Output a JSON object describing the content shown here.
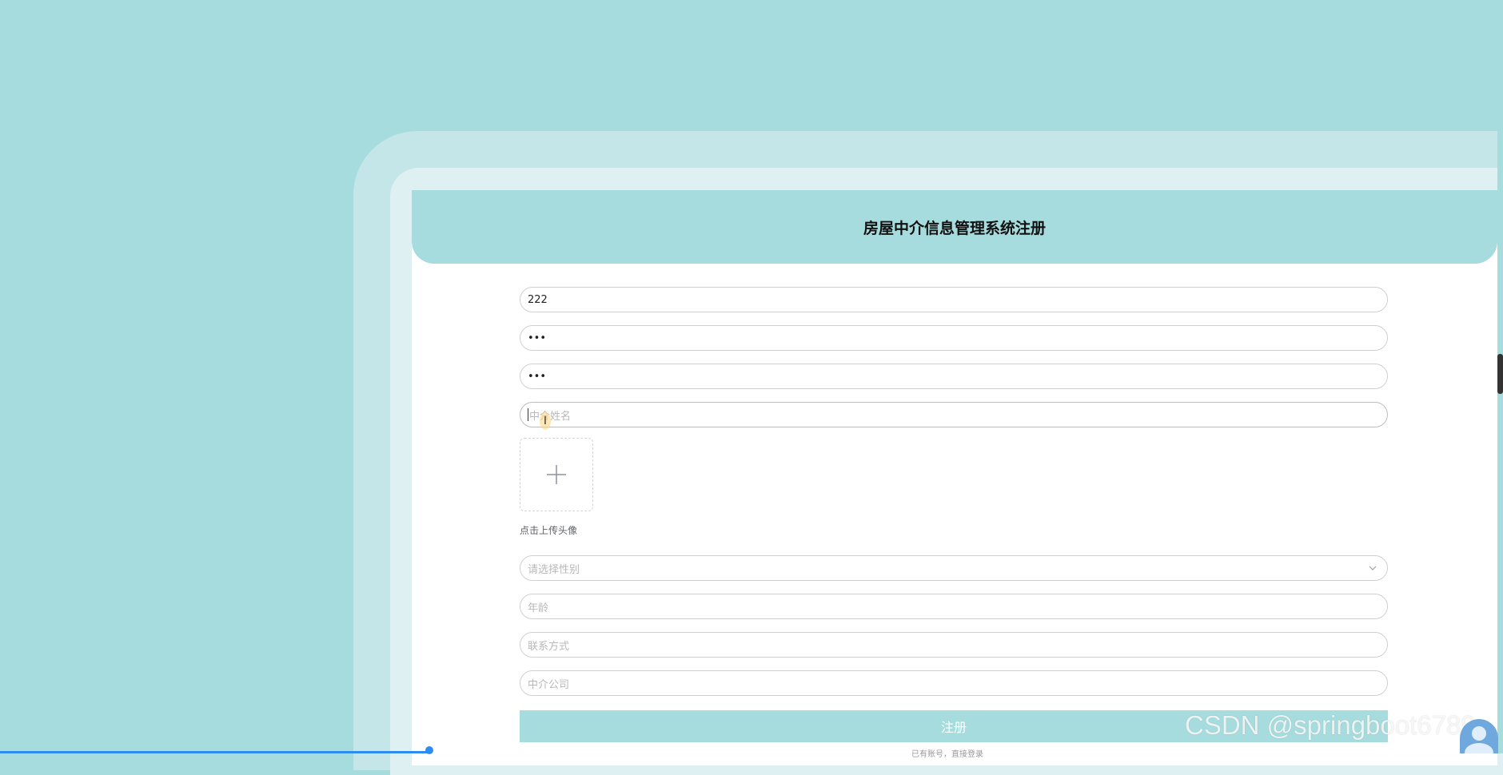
{
  "header": {
    "title": "房屋中介信息管理系统注册"
  },
  "form": {
    "account": {
      "value": "222"
    },
    "password": {
      "value": "•••"
    },
    "confirm_password": {
      "value": "•••"
    },
    "name": {
      "placeholder": "中介姓名"
    },
    "avatar_upload": {
      "label": "点击上传头像"
    },
    "gender": {
      "placeholder": "请选择性别"
    },
    "age": {
      "placeholder": "年龄"
    },
    "contact": {
      "placeholder": "联系方式"
    },
    "company": {
      "placeholder": "中介公司"
    },
    "submit_label": "注册",
    "login_link": "已有账号，直接登录"
  },
  "watermark": "CSDN @springboot6789",
  "colors": {
    "accent": "#a6dcdd",
    "frame": "#c4e6e8",
    "inner": "#dff0f3"
  }
}
